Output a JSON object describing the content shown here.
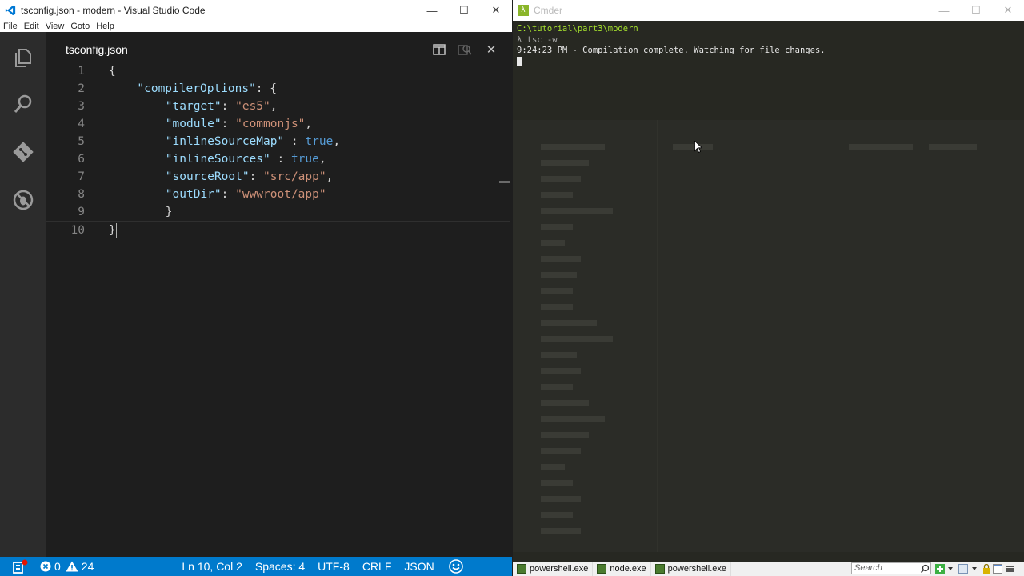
{
  "vscode": {
    "window_title": "tsconfig.json - modern - Visual Studio Code",
    "menu": [
      "File",
      "Edit",
      "View",
      "Goto",
      "Help"
    ],
    "tab_title": "tsconfig.json",
    "activity_icons": [
      "explorer-icon",
      "search-icon",
      "git-icon",
      "debug-icon"
    ],
    "code_lines": [
      {
        "n": "1",
        "indent": 0,
        "tokens": [
          {
            "c": "p",
            "t": "{"
          }
        ]
      },
      {
        "n": "2",
        "indent": 1,
        "tokens": [
          {
            "c": "k",
            "t": "\"compilerOptions\""
          },
          {
            "c": "p",
            "t": ": {"
          }
        ]
      },
      {
        "n": "3",
        "indent": 2,
        "tokens": [
          {
            "c": "k",
            "t": "\"target\""
          },
          {
            "c": "p",
            "t": ": "
          },
          {
            "c": "s",
            "t": "\"es5\""
          },
          {
            "c": "p",
            "t": ","
          }
        ]
      },
      {
        "n": "4",
        "indent": 2,
        "tokens": [
          {
            "c": "k",
            "t": "\"module\""
          },
          {
            "c": "p",
            "t": ": "
          },
          {
            "c": "s",
            "t": "\"commonjs\""
          },
          {
            "c": "p",
            "t": ","
          }
        ]
      },
      {
        "n": "5",
        "indent": 2,
        "tokens": [
          {
            "c": "k",
            "t": "\"inlineSourceMap\""
          },
          {
            "c": "p",
            "t": " : "
          },
          {
            "c": "b",
            "t": "true"
          },
          {
            "c": "p",
            "t": ","
          }
        ]
      },
      {
        "n": "6",
        "indent": 2,
        "tokens": [
          {
            "c": "k",
            "t": "\"inlineSources\""
          },
          {
            "c": "p",
            "t": " : "
          },
          {
            "c": "b",
            "t": "true"
          },
          {
            "c": "p",
            "t": ","
          }
        ]
      },
      {
        "n": "7",
        "indent": 2,
        "tokens": [
          {
            "c": "k",
            "t": "\"sourceRoot\""
          },
          {
            "c": "p",
            "t": ": "
          },
          {
            "c": "s",
            "t": "\"src/app\""
          },
          {
            "c": "p",
            "t": ","
          }
        ]
      },
      {
        "n": "8",
        "indent": 2,
        "tokens": [
          {
            "c": "k",
            "t": "\"outDir\""
          },
          {
            "c": "p",
            "t": ": "
          },
          {
            "c": "s",
            "t": "\"wwwroot/app\""
          }
        ]
      },
      {
        "n": "9",
        "indent": 2,
        "tokens": [
          {
            "c": "p",
            "t": "}"
          }
        ]
      },
      {
        "n": "10",
        "indent": 0,
        "tokens": [
          {
            "c": "p",
            "t": "}"
          }
        ],
        "current": true
      }
    ],
    "status": {
      "errors": "0",
      "warnings": "24",
      "position": "Ln 10, Col 2",
      "spaces": "Spaces: 4",
      "encoding": "UTF-8",
      "eol": "CRLF",
      "language": "JSON"
    }
  },
  "cmder": {
    "window_title": "Cmder",
    "terminal": {
      "path": "C:\\tutorial\\part3\\modern",
      "command": "λ tsc -w",
      "output": "9:24:23 PM - Compilation complete. Watching for file changes."
    },
    "taskbar": {
      "tasks": [
        "powershell.exe",
        "node.exe",
        "powershell.exe"
      ],
      "search_placeholder": "Search"
    }
  }
}
